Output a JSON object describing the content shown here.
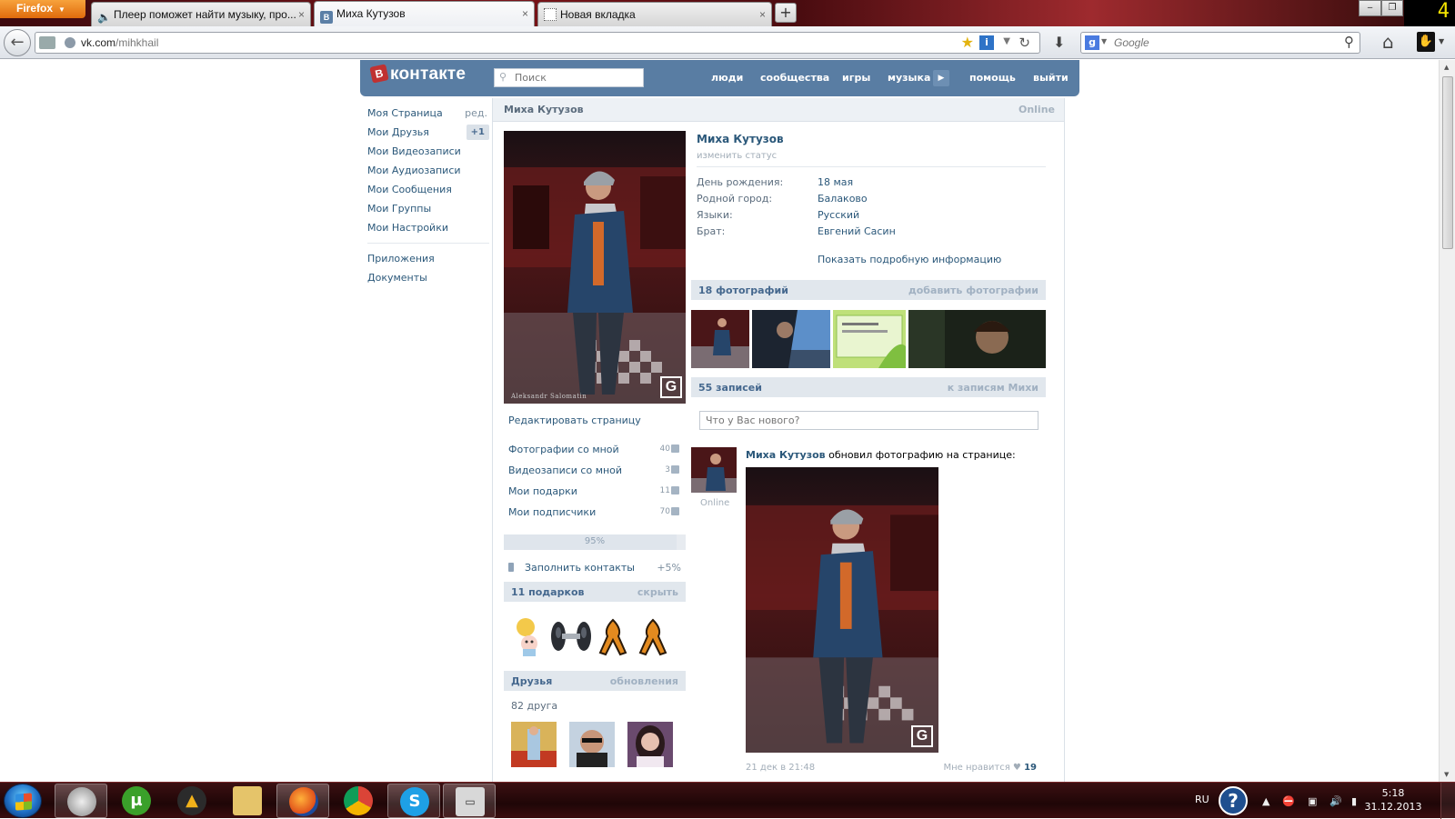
{
  "browser": {
    "menu_button": "Firefox",
    "tabs": [
      {
        "title": "Плеер поможет найти музыку, про..."
      },
      {
        "title": "Миха Кутузов",
        "favicon": "В"
      },
      {
        "title": "Новая вкладка"
      }
    ],
    "new_tab": "+",
    "corner_badge": "4",
    "url": {
      "host": "vk.com",
      "path": "/mihkhail"
    },
    "search_placeholder": "Google",
    "search_engine_letter": "g"
  },
  "vk": {
    "logo_letter": "В",
    "logo_text": "контакте",
    "search_placeholder": "Поиск",
    "nav": [
      "люди",
      "сообщества",
      "игры",
      "музыка",
      "помощь",
      "выйти"
    ],
    "left_menu": [
      {
        "label": "Моя Страница",
        "extra": "ред."
      },
      {
        "label": "Мои Друзья",
        "badge": "+1"
      },
      {
        "label": "Мои Видеозаписи"
      },
      {
        "label": "Мои Аудиозаписи"
      },
      {
        "label": "Мои Сообщения"
      },
      {
        "label": "Мои Группы"
      },
      {
        "label": "Мои Настройки"
      },
      {
        "label": "Приложения"
      },
      {
        "label": "Документы"
      }
    ],
    "profile": {
      "header_name": "Миха Кутузов",
      "header_online": "Online",
      "photo_caption": "Aleksandr Salomatin",
      "watermark": "G",
      "edit_page": "Редактировать страницу",
      "stats": [
        {
          "label": "Фотографии со мной",
          "count": "40"
        },
        {
          "label": "Видеозаписи со мной",
          "count": "3"
        },
        {
          "label": "Мои подарки",
          "count": "11"
        },
        {
          "label": "Мои подписчики",
          "count": "70"
        }
      ],
      "completeness": {
        "percent": 95,
        "label": "95%"
      },
      "fill_contacts": {
        "label": "Заполнить контакты",
        "bonus": "+5%"
      },
      "gifts": {
        "title": "11 подарков",
        "action": "скрыть"
      },
      "friends": {
        "title": "Друзья",
        "action": "обновления",
        "count": "82 друга"
      }
    },
    "info": {
      "name": "Миха Кутузов",
      "status": "изменить статус",
      "rows": [
        {
          "key": "День рождения:",
          "value": "18 мая"
        },
        {
          "key": "Родной город:",
          "value": "Балаково"
        },
        {
          "key": "Языки:",
          "value": "Русский"
        },
        {
          "key": "Брат:",
          "value": "Евгений Сасин"
        }
      ],
      "more": "Показать подробную информацию"
    },
    "photos": {
      "title": "18 фотографий",
      "action": "добавить фотографии"
    },
    "wall": {
      "title": "55 записей",
      "action": "к записям Михи",
      "placeholder": "Что у Вас нового?",
      "post": {
        "author": "Миха Кутузов",
        "action": "обновил фотографию на странице:",
        "online": "Online",
        "date": "21 дек в 21:48",
        "like_label": "Мне нравится",
        "likes": "19"
      }
    }
  },
  "taskbar": {
    "tray_lang": "RU",
    "time": "5:18",
    "date": "31.12.2013"
  }
}
